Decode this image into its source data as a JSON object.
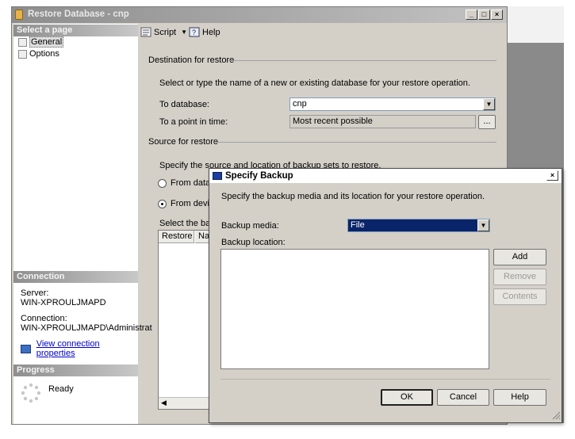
{
  "main_window": {
    "title": "Restore Database - cnp",
    "controls": {
      "minimize": "_",
      "maximize": "□",
      "close": "×"
    }
  },
  "left_pane": {
    "select_page_header": "Select a page",
    "pages": [
      {
        "label": "General",
        "icon": "page-icon",
        "selected": true
      },
      {
        "label": "Options",
        "icon": "page-icon",
        "selected": false
      }
    ],
    "connection_header": "Connection",
    "server_label": "Server:",
    "server_value": "WIN-XPROULJMAPD",
    "connection_label": "Connection:",
    "connection_value": "WIN-XPROULJMAPD\\Administrat",
    "view_connection_link": "View connection properties",
    "progress_header": "Progress",
    "progress_status": "Ready"
  },
  "toolbar": {
    "script_label": "Script",
    "help_label": "Help"
  },
  "destination": {
    "section_title": "Destination for restore",
    "description": "Select or type the name of a new or existing database for your restore operation.",
    "to_database_label": "To database:",
    "to_database_value": "cnp",
    "point_in_time_label": "To a point in time:",
    "point_in_time_value": "Most recent possible",
    "browse_button": "..."
  },
  "source": {
    "section_title": "Source for restore",
    "description": "Specify the source and location of backup sets to restore.",
    "from_database_label": "From datab",
    "from_device_label": "From devic",
    "select_backup_label": "Select the bac",
    "grid_columns": [
      "Restore",
      "Na"
    ]
  },
  "dialog": {
    "title": "Specify Backup",
    "close": "×",
    "description": "Specify the backup media and its location for your restore operation.",
    "backup_media_label": "Backup media:",
    "backup_media_value": "File",
    "backup_location_label": "Backup location:",
    "add_button": "Add",
    "remove_button": "Remove",
    "contents_button": "Contents",
    "ok_button": "OK",
    "cancel_button": "Cancel",
    "help_button": "Help"
  },
  "colors": {
    "dialog_face": "#d4d0c8",
    "selection_blue": "#0a246a",
    "link_blue": "#0000cc"
  }
}
